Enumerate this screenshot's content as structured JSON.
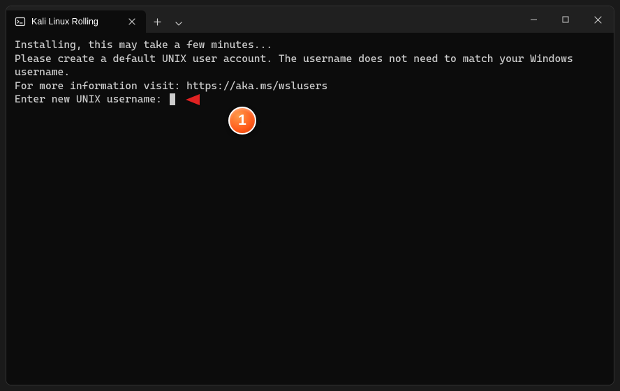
{
  "tab": {
    "title": "Kali Linux Rolling"
  },
  "terminal": {
    "line1": "Installing, this may take a few minutes...",
    "line2": "Please create a default UNIX user account. The username does not need to match your Windows username.",
    "line3": "For more information visit: https://aka.ms/wslusers",
    "line4": "Enter new UNIX username: "
  },
  "annotation": {
    "badge_number": "1"
  }
}
